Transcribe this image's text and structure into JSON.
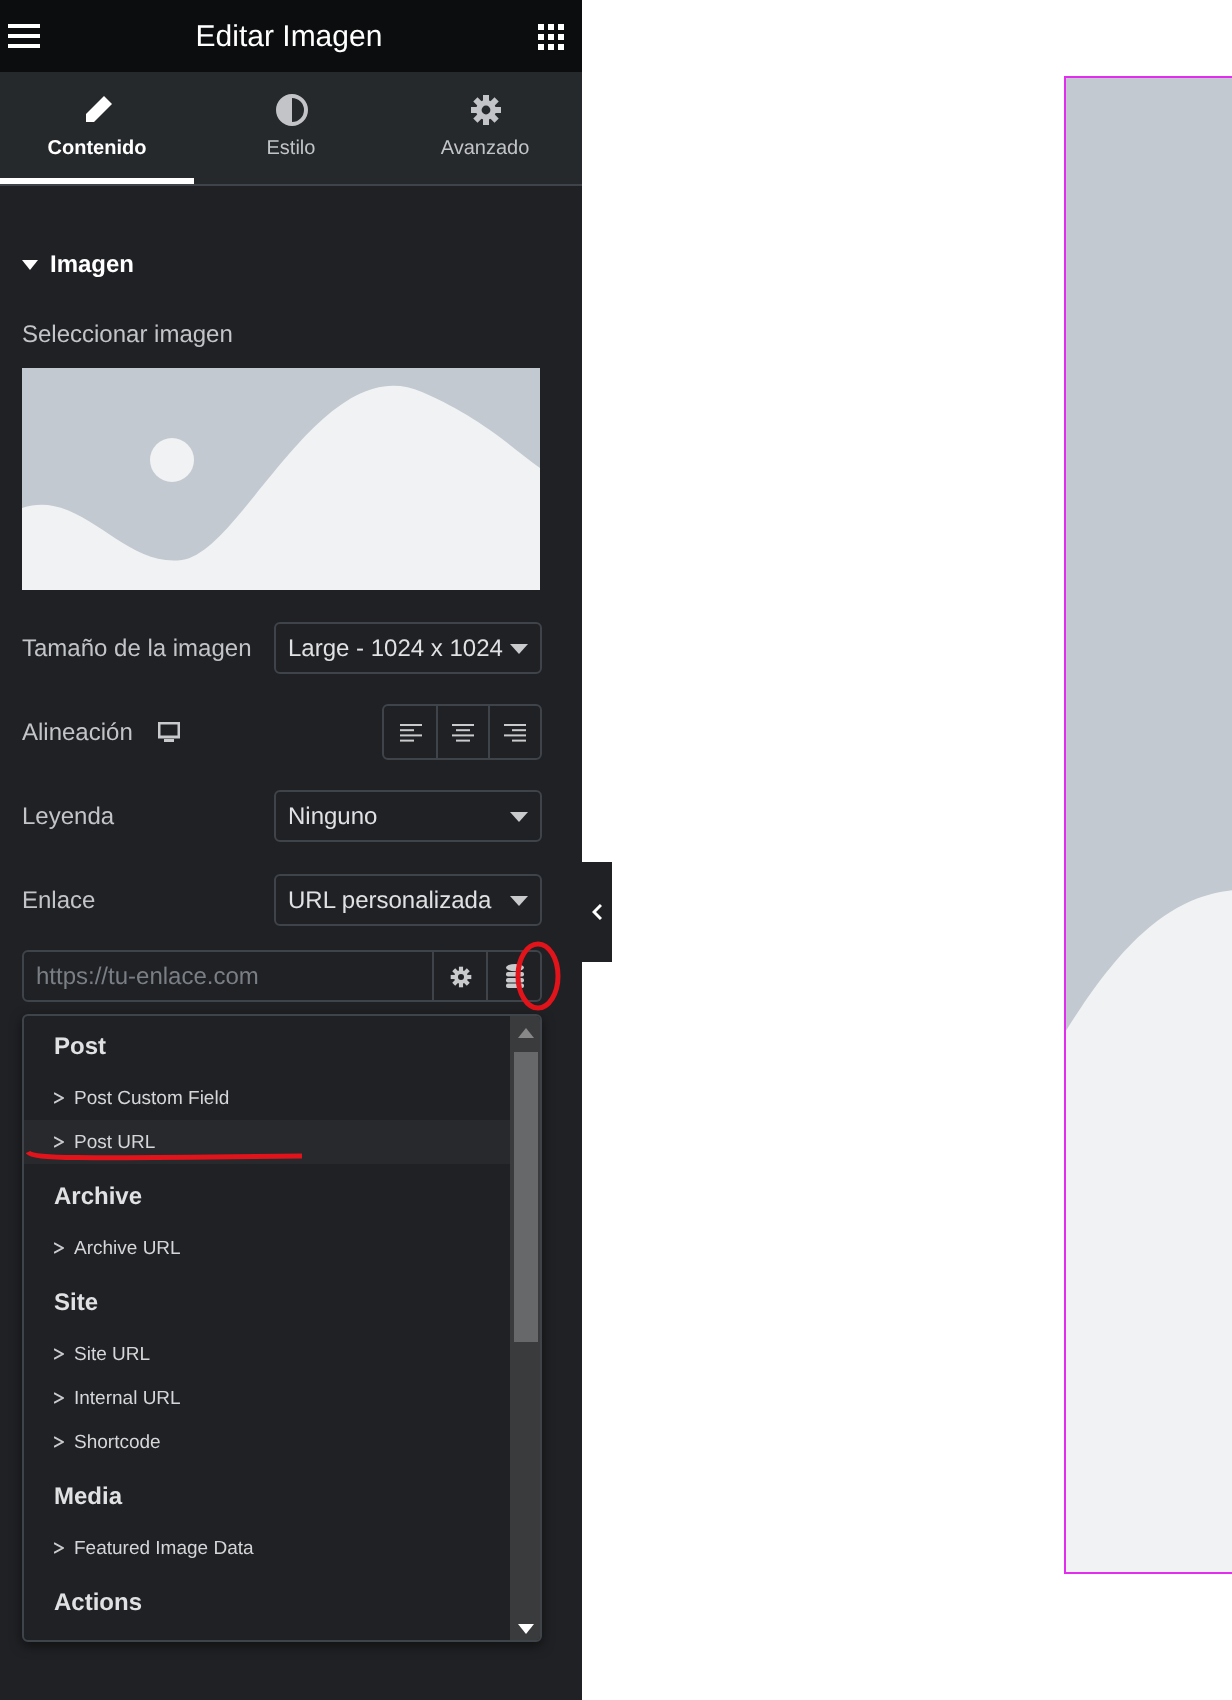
{
  "header": {
    "title": "Editar Imagen"
  },
  "tabs": [
    {
      "label": "Contenido",
      "selected": true
    },
    {
      "label": "Estilo",
      "selected": false
    },
    {
      "label": "Avanzado",
      "selected": false
    }
  ],
  "section": {
    "title": "Imagen",
    "expanded": true
  },
  "image_control": {
    "label": "Seleccionar imagen"
  },
  "fields": [
    {
      "kind": "select",
      "label": "Tamaño de la imagen",
      "value": "Large - 1024 x 1024"
    },
    {
      "kind": "align",
      "label": "Alineación"
    },
    {
      "kind": "select",
      "label": "Leyenda",
      "value": "Ninguno"
    },
    {
      "kind": "select",
      "label": "Enlace",
      "value": "URL personalizada"
    }
  ],
  "url_field": {
    "placeholder": "https://tu-enlace.com"
  },
  "dynamic_menu": {
    "groups": [
      {
        "title": "Post",
        "items": [
          {
            "label": "Post Custom Field",
            "selected": false
          },
          {
            "label": "Post URL",
            "selected": true
          }
        ]
      },
      {
        "title": "Archive",
        "items": [
          {
            "label": "Archive URL",
            "selected": false
          }
        ]
      },
      {
        "title": "Site",
        "items": [
          {
            "label": "Site URL",
            "selected": false
          },
          {
            "label": "Internal URL",
            "selected": false
          },
          {
            "label": "Shortcode",
            "selected": false
          }
        ]
      },
      {
        "title": "Media",
        "items": [
          {
            "label": "Featured Image Data",
            "selected": false
          }
        ]
      },
      {
        "title": "Actions"
      }
    ]
  }
}
